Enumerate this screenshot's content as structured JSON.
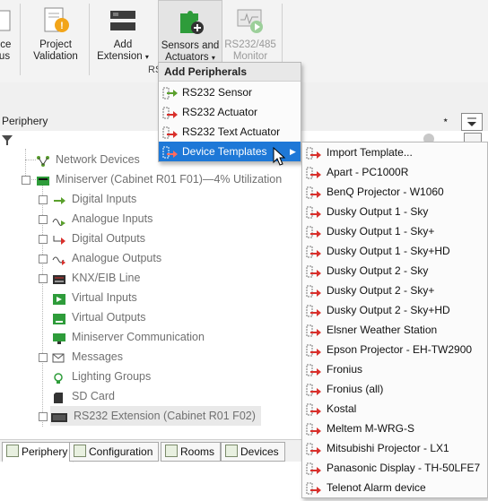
{
  "ribbon": {
    "buttons": [
      {
        "label_line1": "ice",
        "label_line2": "us"
      },
      {
        "label_line1": "Project",
        "label_line2": "Validation"
      },
      {
        "label_line1": "Add",
        "label_line2": "Extension"
      },
      {
        "label_line1": "Sensors and",
        "label_line2": "Actuators"
      },
      {
        "label_line1": "RS232/485",
        "label_line2": "Monitor"
      }
    ],
    "group_label": "RS"
  },
  "periphery": {
    "title": "Periphery",
    "pin_glyph": "⭑"
  },
  "tree": {
    "items": [
      {
        "label": "Network Devices"
      },
      {
        "label": "Miniserver (Cabinet R01 F01)—4% Utilization"
      },
      {
        "label": "Digital Inputs"
      },
      {
        "label": "Analogue Inputs"
      },
      {
        "label": "Digital Outputs"
      },
      {
        "label": "Analogue Outputs"
      },
      {
        "label": "KNX/EIB Line"
      },
      {
        "label": "Virtual Inputs"
      },
      {
        "label": "Virtual Outputs"
      },
      {
        "label": "Miniserver Communication"
      },
      {
        "label": "Messages"
      },
      {
        "label": "Lighting Groups"
      },
      {
        "label": "SD Card"
      },
      {
        "label": "RS232 Extension (Cabinet R01 F02)"
      }
    ]
  },
  "tabs": [
    {
      "label": "Periphery"
    },
    {
      "label": "Configuration"
    },
    {
      "label": "Rooms"
    },
    {
      "label": "Devices"
    }
  ],
  "add_menu": {
    "header": "Add Peripherals",
    "items": [
      {
        "label": "RS232 Sensor"
      },
      {
        "label": "RS232 Actuator"
      },
      {
        "label": "RS232 Text Actuator"
      },
      {
        "label": "Device Templates"
      }
    ]
  },
  "templates_menu": {
    "items": [
      {
        "label": "Import Template..."
      },
      {
        "label": "Apart - PC1000R"
      },
      {
        "label": "BenQ Projector - W1060"
      },
      {
        "label": "Dusky Output 1 - Sky"
      },
      {
        "label": "Dusky Output 1 - Sky+"
      },
      {
        "label": "Dusky Output 1 - Sky+HD"
      },
      {
        "label": "Dusky Output 2 - Sky"
      },
      {
        "label": "Dusky Output 2 - Sky+"
      },
      {
        "label": "Dusky Output 2 - Sky+HD"
      },
      {
        "label": "Elsner Weather Station"
      },
      {
        "label": "Epson Projector - EH-TW2900"
      },
      {
        "label": "Fronius"
      },
      {
        "label": "Fronius (all)"
      },
      {
        "label": "Kostal"
      },
      {
        "label": "Meltem M-WRG-S"
      },
      {
        "label": "Mitsubishi Projector - LX1"
      },
      {
        "label": "Panasonic Display - TH-50LFE7"
      },
      {
        "label": "Telenot Alarm device"
      }
    ]
  },
  "colors": {
    "highlight": "#1e78d7",
    "sensor_arrow": "#5aa02c",
    "actuator_arrow": "#d9302c"
  }
}
